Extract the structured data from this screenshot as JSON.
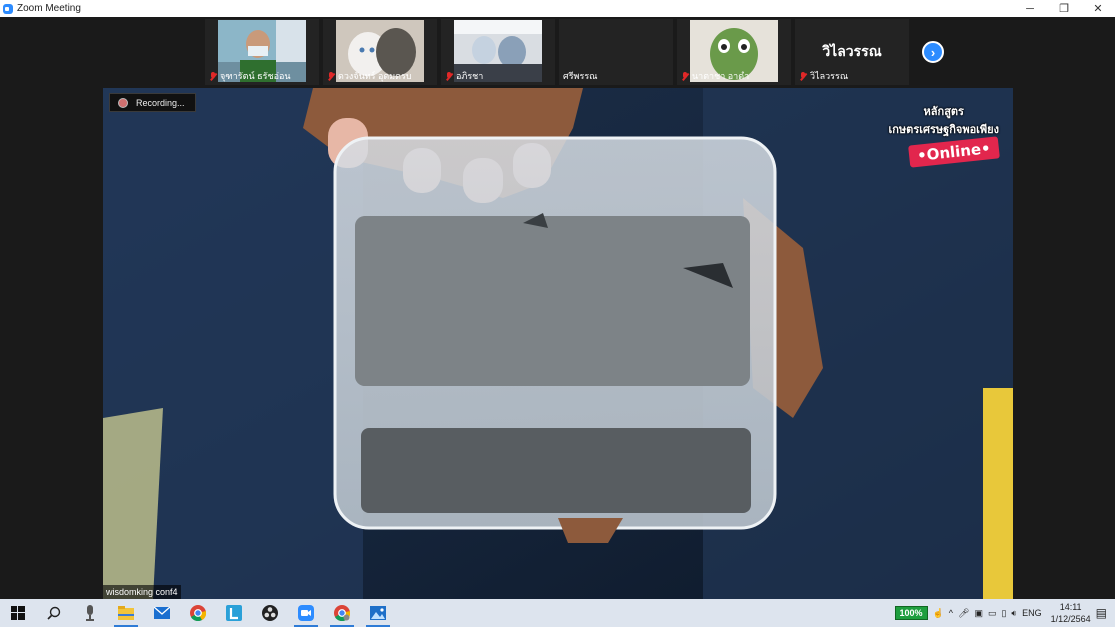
{
  "window": {
    "title": "Zoom Meeting",
    "controls": [
      "─",
      "❐",
      "✕"
    ]
  },
  "gallery": {
    "participants": [
      {
        "name": "จุฑารัตน์ ธรัชอ่อน",
        "muted": true,
        "video": true
      },
      {
        "name": "ดวงจันทร์ อุดมดรบ",
        "muted": true,
        "video": true
      },
      {
        "name": "อภิรชา",
        "muted": true,
        "video": true
      },
      {
        "name": "ศรีพรรณ",
        "muted": false,
        "video": false
      },
      {
        "name": "นาตาชา อาดำ",
        "muted": true,
        "video": true
      },
      {
        "name": "วิไลวรรณ",
        "muted": true,
        "video": false,
        "display_name": "วิไลวรรณ"
      }
    ],
    "next_icon": "chevron-right-icon"
  },
  "main": {
    "recording_label": "Recording...",
    "overlay": {
      "line1": "หลักสูตร",
      "line2": "เกษตรเศรษฐกิจพอเพียง",
      "badge": "•Online•"
    },
    "active_speaker": "wisdomking conf4"
  },
  "taskbar": {
    "apps": [
      "windows-start-icon",
      "search-icon",
      "microphone-app-icon",
      "file-explorer-icon",
      "mail-icon",
      "chrome-icon",
      "l-app-icon",
      "obs-icon",
      "zoom-icon",
      "chrome-profile-icon",
      "photos-icon"
    ],
    "battery": "100%",
    "language": "ENG",
    "time": "14:11",
    "date": "1/12/2564"
  },
  "colors": {
    "accent": "#2d8cff",
    "mute_red": "#e02828",
    "online_badge": "#e2264d",
    "battery_green": "#1e9e3e"
  }
}
